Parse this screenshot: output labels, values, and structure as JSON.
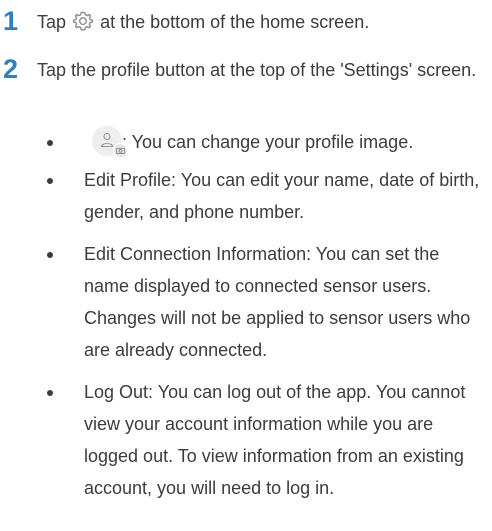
{
  "steps": [
    {
      "number": "1",
      "text_before": "Tap",
      "icon": "gear-icon",
      "text_after": "at the bottom of the home screen."
    },
    {
      "number": "2",
      "text": "Tap the profile button at the top of the 'Settings' screen.",
      "bullets": [
        {
          "icon": "profile-image-icon",
          "text": ": You can change your profile image."
        },
        {
          "text": "Edit Profile: You can edit your name, date of birth, gender, and phone number."
        },
        {
          "text": "Edit Connection Information: You can set the name displayed to connected sensor users. Changes will not be applied to sensor users who are already connected."
        },
        {
          "text": "Log Out: You can log out of the app. You cannot view your account information while you are logged out. To view information from an existing account, you will need to log in."
        }
      ]
    }
  ],
  "colors": {
    "step_number": "#2f7fc7",
    "body_text": "#3c3c3c",
    "icon_stroke": "#8a8a8a",
    "avatar_bg": "#eeeeee"
  }
}
